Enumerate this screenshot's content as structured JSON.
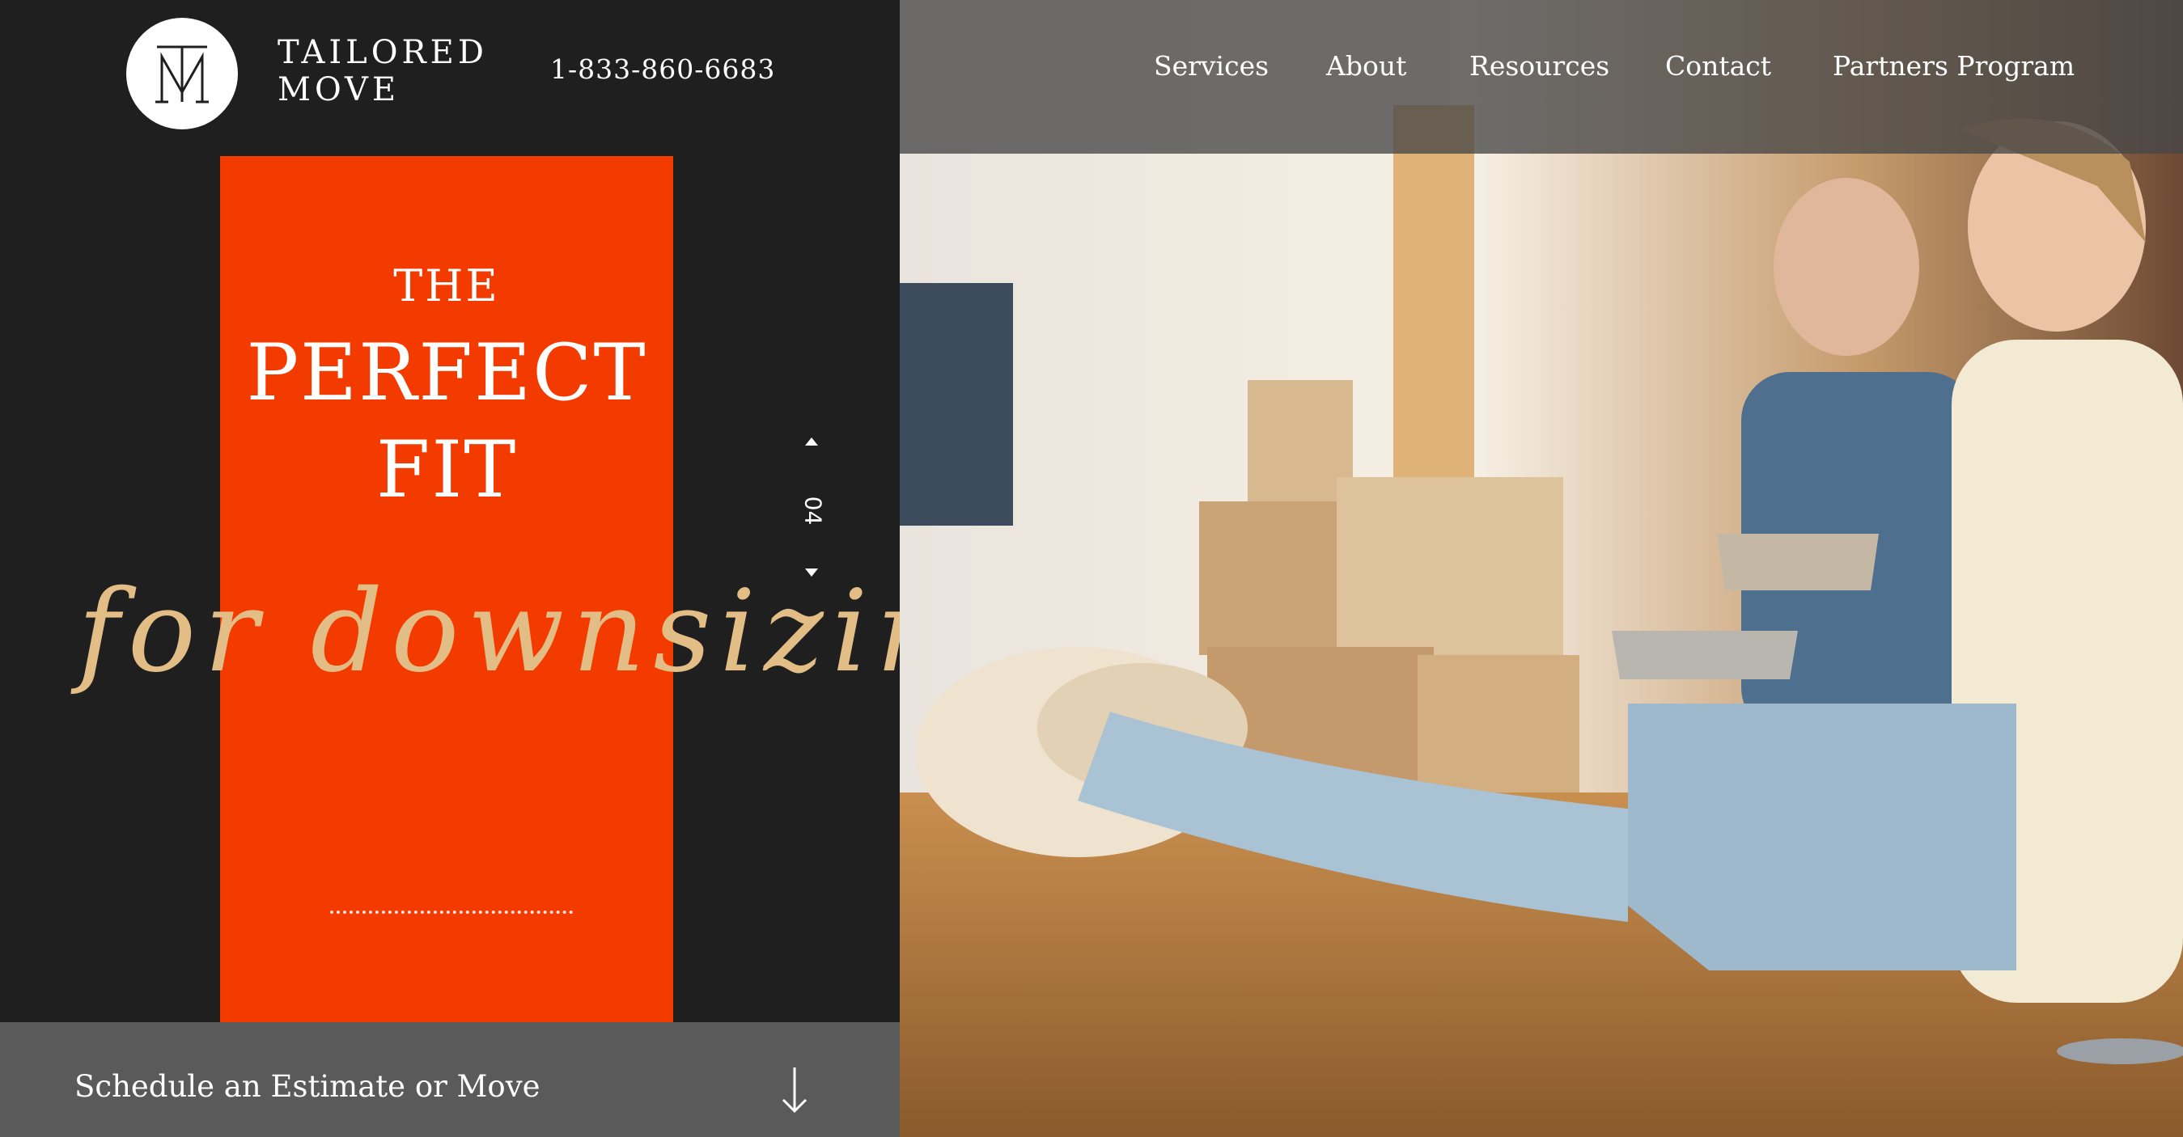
{
  "brand": {
    "line1": "TAILORED",
    "line2": "MOVE",
    "logo_icon": "tm-monogram-icon"
  },
  "phone": "1-833-860-6683",
  "nav": {
    "items": [
      {
        "label": "Services"
      },
      {
        "label": "About"
      },
      {
        "label": "Resources"
      },
      {
        "label": "Contact"
      },
      {
        "label": "Partners Program"
      }
    ]
  },
  "hero": {
    "line1": "THE",
    "line2": "PERFECT",
    "line3": "FIT",
    "script": "for downsizing.",
    "slide_number": "04"
  },
  "cta": {
    "label": "Schedule an Estimate or Move",
    "icon": "arrow-down-icon"
  },
  "colors": {
    "accent": "#f33b00",
    "dark": "#1f1f1f",
    "script": "#e2bd86",
    "cta_bg": "#5a5a5a"
  }
}
